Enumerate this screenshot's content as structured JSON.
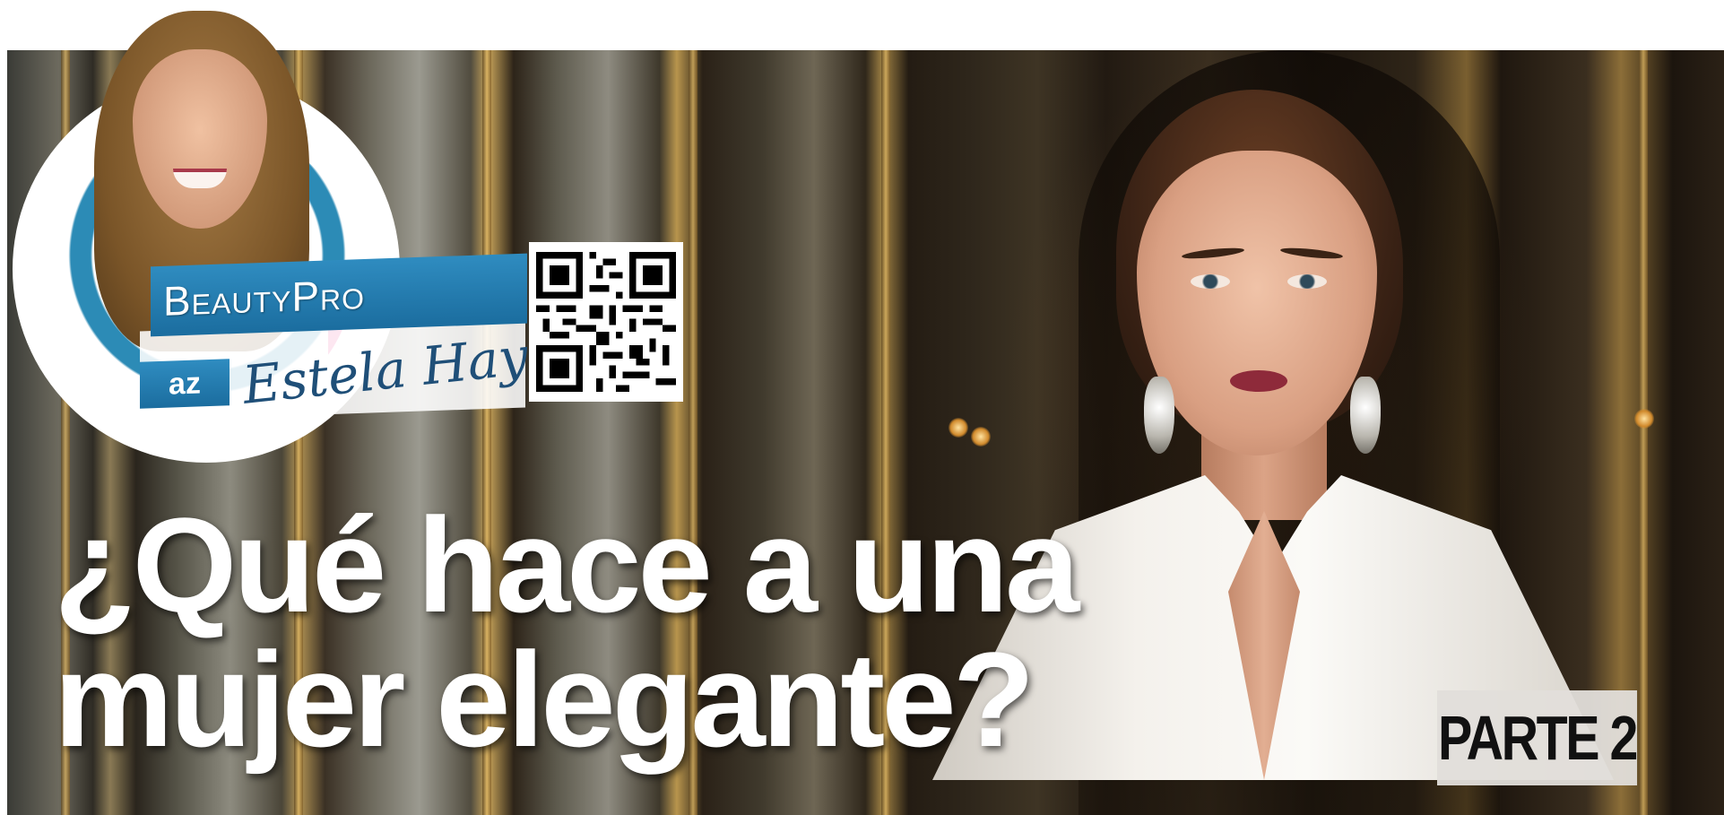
{
  "brand": {
    "name": "BeautyPro",
    "badge": "az",
    "signature": "Estela Hayes"
  },
  "headline": {
    "line1": "¿Qué hace a una",
    "line2": "mujer elegante?"
  },
  "part_label": "PARTE 2",
  "colors": {
    "brand_blue": "#2f8cc0",
    "accent_pink": "#e93a8f",
    "signature_blue": "#1f4f78",
    "headline_text": "#ffffff",
    "badge_bg": "#e1ded9"
  },
  "icons": {
    "qr": "qr-code-icon"
  }
}
